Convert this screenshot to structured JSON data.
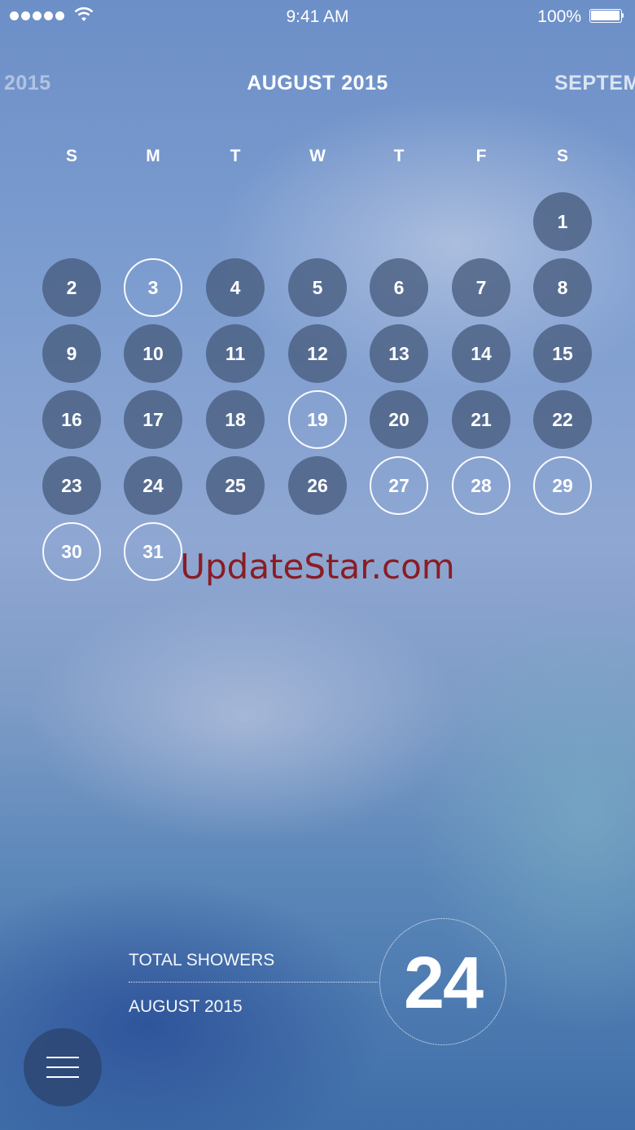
{
  "status_bar": {
    "signal_dots": 5,
    "time": "9:41 AM",
    "battery": "100%",
    "wifi_icon": "wifi-icon",
    "battery_icon": "battery-icon"
  },
  "header": {
    "prev_month": "2015",
    "current_month": "AUGUST 2015",
    "next_month": "SEPTEM"
  },
  "weekdays": [
    "S",
    "M",
    "T",
    "W",
    "T",
    "F",
    "S"
  ],
  "calendar": {
    "first_weekday_index": 6,
    "days": [
      {
        "d": "1",
        "outlined": false
      },
      {
        "d": "2",
        "outlined": false
      },
      {
        "d": "3",
        "outlined": true
      },
      {
        "d": "4",
        "outlined": false
      },
      {
        "d": "5",
        "outlined": false
      },
      {
        "d": "6",
        "outlined": false
      },
      {
        "d": "7",
        "outlined": false
      },
      {
        "d": "8",
        "outlined": false
      },
      {
        "d": "9",
        "outlined": false
      },
      {
        "d": "10",
        "outlined": false
      },
      {
        "d": "11",
        "outlined": false
      },
      {
        "d": "12",
        "outlined": false
      },
      {
        "d": "13",
        "outlined": false
      },
      {
        "d": "14",
        "outlined": false
      },
      {
        "d": "15",
        "outlined": false
      },
      {
        "d": "16",
        "outlined": false
      },
      {
        "d": "17",
        "outlined": false
      },
      {
        "d": "18",
        "outlined": false
      },
      {
        "d": "19",
        "outlined": true
      },
      {
        "d": "20",
        "outlined": false
      },
      {
        "d": "21",
        "outlined": false
      },
      {
        "d": "22",
        "outlined": false
      },
      {
        "d": "23",
        "outlined": false
      },
      {
        "d": "24",
        "outlined": false
      },
      {
        "d": "25",
        "outlined": false
      },
      {
        "d": "26",
        "outlined": false
      },
      {
        "d": "27",
        "outlined": true
      },
      {
        "d": "28",
        "outlined": true
      },
      {
        "d": "29",
        "outlined": true
      },
      {
        "d": "30",
        "outlined": true
      },
      {
        "d": "31",
        "outlined": true
      }
    ]
  },
  "watermark": "UpdateStar.com",
  "stats": {
    "label": "TOTAL SHOWERS",
    "period": "AUGUST 2015",
    "total": "24"
  },
  "menu": {
    "icon": "hamburger-menu-icon"
  }
}
